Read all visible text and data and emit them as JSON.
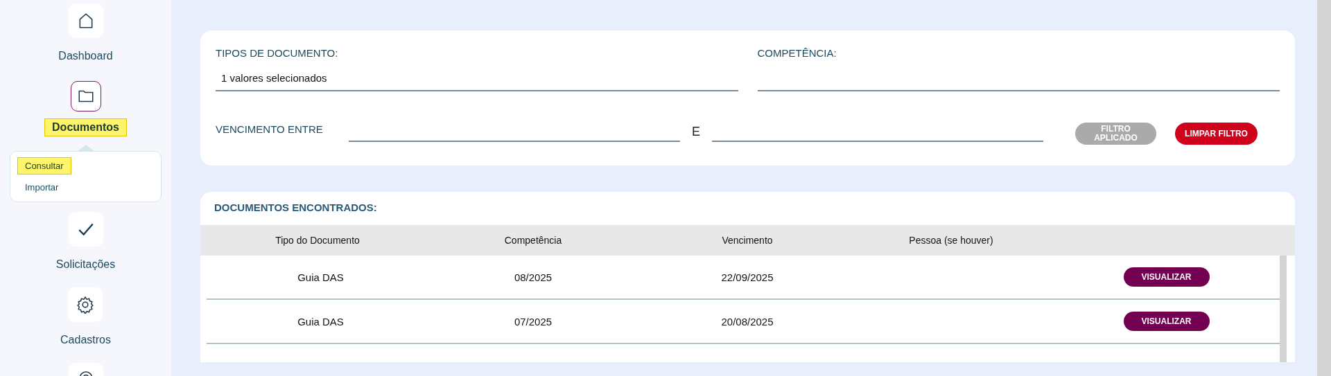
{
  "sidebar": {
    "items": [
      {
        "label": "Dashboard",
        "selected": false
      },
      {
        "label": "Documentos",
        "selected": true,
        "submenu": [
          {
            "label": "Consultar",
            "selected": true
          },
          {
            "label": "Importar",
            "selected": false
          }
        ]
      },
      {
        "label": "Solicitações",
        "selected": false
      },
      {
        "label": "Cadastros",
        "selected": false
      },
      {
        "selected": false
      }
    ]
  },
  "filters": {
    "document_types": {
      "label": "TIPOS DE DOCUMENTO:",
      "value": "1 valores selecionados"
    },
    "competencia": {
      "label": "COMPETÊNCIA:"
    },
    "due_between": {
      "label": "VENCIMENTO ENTRE",
      "separator": "E"
    },
    "buttons": [
      {
        "label": "FILTRO APLICADO",
        "disabled": true
      },
      {
        "label": "LIMPAR FILTRO",
        "disabled": false
      }
    ]
  },
  "results": {
    "title": "DOCUMENTOS ENCONTRADOS:",
    "columns": [
      "Tipo do Documento",
      "Competência",
      "Vencimento",
      "Pessoa (se houver)"
    ],
    "rows": [
      {
        "cells": [
          "Guia DAS",
          "08/2025",
          "22/09/2025",
          ""
        ],
        "action": "VISUALIZAR"
      },
      {
        "cells": [
          "Guia DAS",
          "07/2025",
          "20/08/2025",
          ""
        ],
        "action": "VISUALIZAR"
      }
    ]
  }
}
